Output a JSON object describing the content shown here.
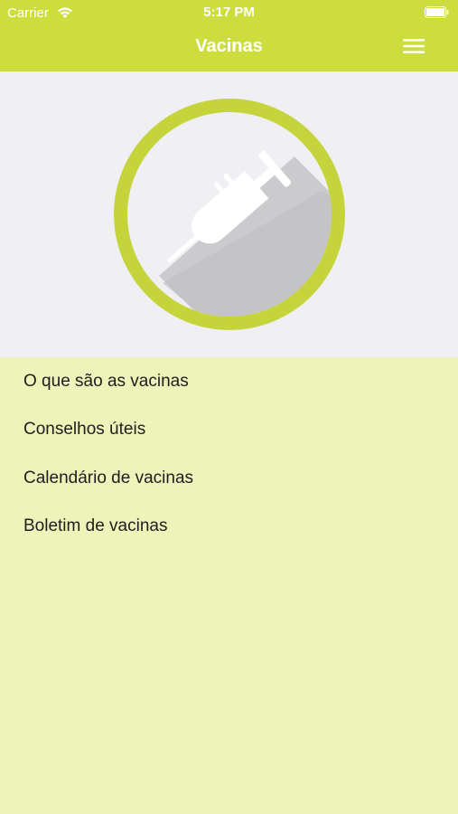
{
  "status_bar": {
    "carrier": "Carrier",
    "time": "5:17 PM"
  },
  "navbar": {
    "title": "Vacinas",
    "menu_icon": "hamburger-menu-icon"
  },
  "hero": {
    "icon": "syringe-icon"
  },
  "menu": {
    "items": [
      {
        "label": "O que são as vacinas"
      },
      {
        "label": "Conselhos úteis"
      },
      {
        "label": "Calendário de vacinas"
      },
      {
        "label": "Boletim de vacinas"
      }
    ]
  },
  "colors": {
    "accent": "#cddd3d",
    "list_background": "#edf3b9",
    "hero_background": "#efeff4",
    "ring": "#c5d43b"
  }
}
